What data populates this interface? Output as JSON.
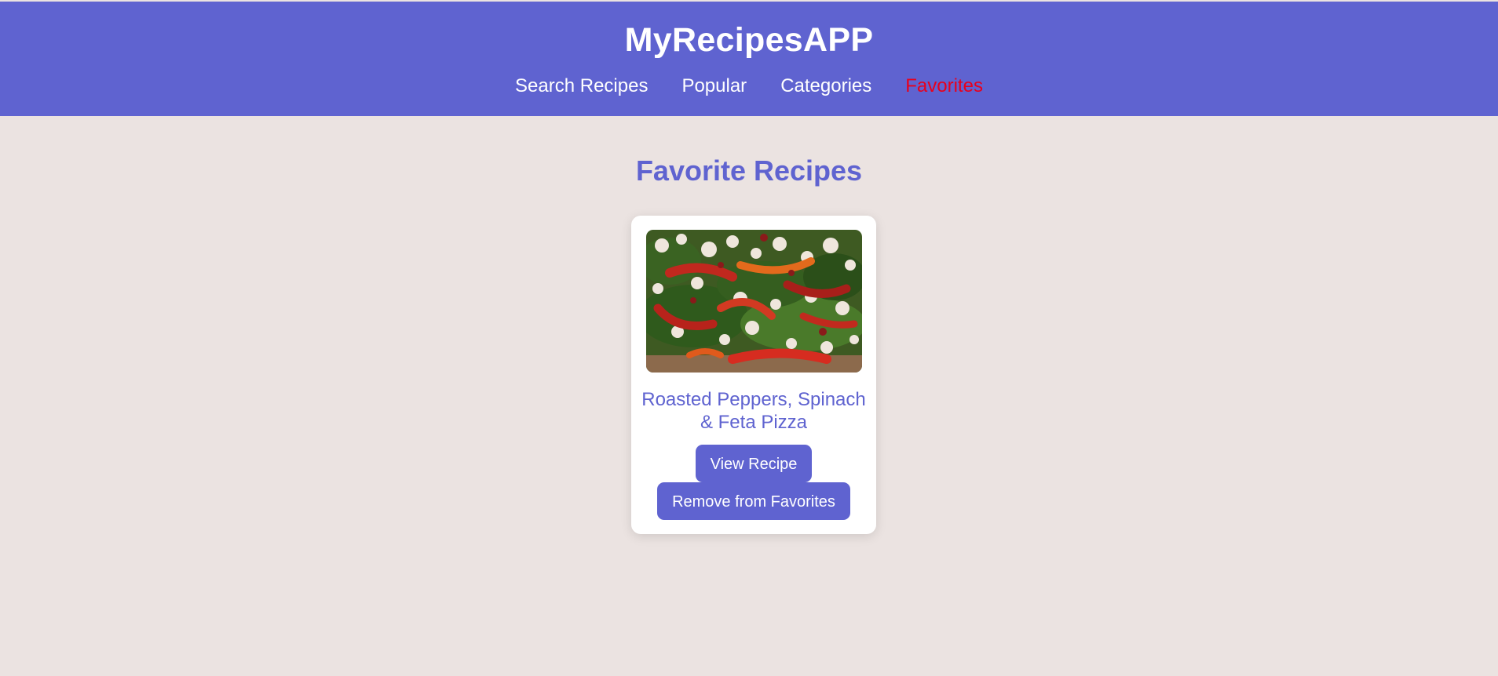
{
  "header": {
    "app_title": "MyRecipesAPP",
    "nav": [
      {
        "label": "Search Recipes",
        "active": false
      },
      {
        "label": "Popular",
        "active": false
      },
      {
        "label": "Categories",
        "active": false
      },
      {
        "label": "Favorites",
        "active": true
      }
    ]
  },
  "main": {
    "page_title": "Favorite Recipes",
    "cards": [
      {
        "title": "Roasted Peppers, Spinach & Feta Pizza",
        "view_label": "View Recipe",
        "remove_label": "Remove from Favorites"
      }
    ]
  },
  "colors": {
    "brand": "#5f63d0",
    "active_nav": "#e8001c",
    "page_bg": "#ebe3e1",
    "card_bg": "#ffffff"
  }
}
